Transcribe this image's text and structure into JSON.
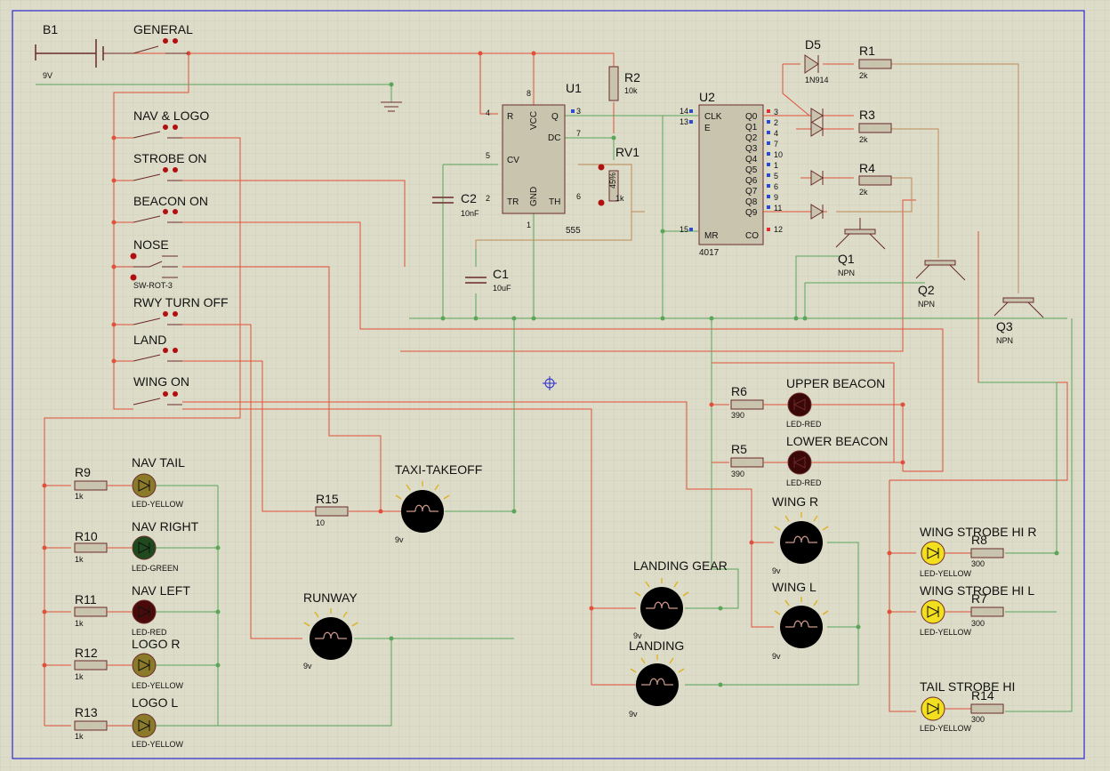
{
  "colors": {
    "background": "#dcdcc8",
    "grid": "#c6c6b4",
    "border": "#2a2ad0",
    "wire_power": "#e0503a",
    "wire_ground": "#5aa55a",
    "component": "#6b2a2a",
    "terminal": "#b01010",
    "pin_blue": "#2a4ad0",
    "pin_red": "#e03030"
  },
  "battery": {
    "ref": "B1",
    "value": "9V"
  },
  "switches": {
    "general": "GENERAL",
    "nav_logo": "NAV & LOGO",
    "strobe_on": "STROBE ON",
    "beacon_on": "BEACON ON",
    "nose": "NOSE",
    "nose_type": "SW-ROT-3",
    "rwy_turn_off": "RWY TURN OFF",
    "land": "LAND",
    "wing_on": "WING ON"
  },
  "u1": {
    "ref": "U1",
    "type": "555",
    "pins": {
      "r": "R",
      "vcc": "VCC",
      "q": "Q",
      "dc": "DC",
      "cv": "CV",
      "tr": "TR",
      "gnd": "GND",
      "th": "TH"
    },
    "pin_numbers": {
      "r": "4",
      "vcc": "8",
      "q": "3",
      "dc": "7",
      "cv": "5",
      "tr": "2",
      "gnd": "1",
      "th": "6"
    }
  },
  "u2": {
    "ref": "U2",
    "type": "4017",
    "pins": {
      "clk": "CLK",
      "e": "E",
      "mr": "MR",
      "q0": "Q0",
      "q1": "Q1",
      "q2": "Q2",
      "q3": "Q3",
      "q4": "Q4",
      "q5": "Q5",
      "q6": "Q6",
      "q7": "Q7",
      "q8": "Q8",
      "q9": "Q9",
      "co": "CO"
    },
    "pin_numbers": {
      "clk": "14",
      "e": "13",
      "mr": "15",
      "q0": "3",
      "q1": "2",
      "q2": "4",
      "q3": "7",
      "q4": "10",
      "q5": "1",
      "q6": "5",
      "q7": "6",
      "q8": "9",
      "q9": "11",
      "co": "12"
    }
  },
  "r2": {
    "ref": "R2",
    "value": "10k"
  },
  "rv1": {
    "ref": "RV1",
    "value": "1k",
    "percent": "45%"
  },
  "c2": {
    "ref": "C2",
    "value": "10nF"
  },
  "c1": {
    "ref": "C1",
    "value": "10uF"
  },
  "d5": {
    "ref": "D5",
    "value": "1N914"
  },
  "r1": {
    "ref": "R1",
    "value": "2k"
  },
  "r3": {
    "ref": "R3",
    "value": "2k"
  },
  "r4": {
    "ref": "R4",
    "value": "2k"
  },
  "q1": {
    "ref": "Q1",
    "type": "NPN"
  },
  "q2": {
    "ref": "Q2",
    "type": "NPN"
  },
  "q3": {
    "ref": "Q3",
    "type": "NPN"
  },
  "r6": {
    "ref": "R6",
    "value": "390"
  },
  "r5": {
    "ref": "R5",
    "value": "390"
  },
  "upper_beacon": {
    "name": "UPPER BEACON",
    "type": "LED-RED"
  },
  "lower_beacon": {
    "name": "LOWER BEACON",
    "type": "LED-RED"
  },
  "r9": {
    "ref": "R9",
    "value": "1k"
  },
  "r10": {
    "ref": "R10",
    "value": "1k"
  },
  "r11": {
    "ref": "R11",
    "value": "1k"
  },
  "r12": {
    "ref": "R12",
    "value": "1k"
  },
  "r13": {
    "ref": "R13",
    "value": "1k"
  },
  "nav_tail": {
    "name": "NAV TAIL",
    "type": "LED-YELLOW"
  },
  "nav_right": {
    "name": "NAV RIGHT",
    "type": "LED-GREEN"
  },
  "nav_left": {
    "name": "NAV LEFT",
    "type": "LED-RED"
  },
  "logo_r": {
    "name": "LOGO R",
    "type": "LED-YELLOW"
  },
  "logo_l": {
    "name": "LOGO L",
    "type": "LED-YELLOW"
  },
  "r15": {
    "ref": "R15",
    "value": "10"
  },
  "taxi_takeoff": {
    "name": "TAXI-TAKEOFF",
    "value": "9v"
  },
  "runway": {
    "name": "RUNWAY",
    "value": "9v"
  },
  "landing_gear": {
    "name": "LANDING GEAR",
    "value": "9v"
  },
  "landing": {
    "name": "LANDING",
    "value": "9v"
  },
  "wing_r": {
    "name": "WING R",
    "value": "9v"
  },
  "wing_l": {
    "name": "WING L",
    "value": "9v"
  },
  "wing_strobe_hi_r": {
    "name": "WING STROBE HI R",
    "type": "LED-YELLOW"
  },
  "wing_strobe_hi_l": {
    "name": "WING STROBE HI L",
    "type": "LED-YELLOW"
  },
  "tail_strobe_hi": {
    "name": "TAIL STROBE HI",
    "type": "LED-YELLOW"
  },
  "r8": {
    "ref": "R8",
    "value": "300"
  },
  "r7": {
    "ref": "R7",
    "value": "300"
  },
  "r14": {
    "ref": "R14",
    "value": "300"
  }
}
